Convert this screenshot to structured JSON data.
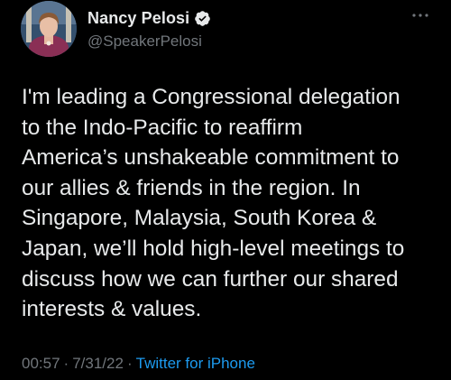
{
  "author": {
    "display_name": "Nancy Pelosi",
    "handle": "@SpeakerPelosi",
    "verified": true,
    "avatar_icon": "profile-photo"
  },
  "tweet": {
    "text": "I'm leading a Congressional delegation\nto the Indo-Pacific to reaffirm\nAmerica’s unshakeable commitment to\nour allies & friends in the region. In\nSingapore, Malaysia, South Korea &\nJapan, we’ll hold high-level meetings to\ndiscuss how we can further our shared\ninterests & values.",
    "time": "00:57",
    "date": "7/31/22",
    "source": "Twitter for iPhone",
    "separator": "·"
  },
  "colors": {
    "background": "#000000",
    "text": "#e7e9ea",
    "secondary": "#71767b",
    "accent": "#1d9bf0"
  },
  "icons": {
    "verified": "verified-badge-icon",
    "more": "more-options-icon"
  }
}
